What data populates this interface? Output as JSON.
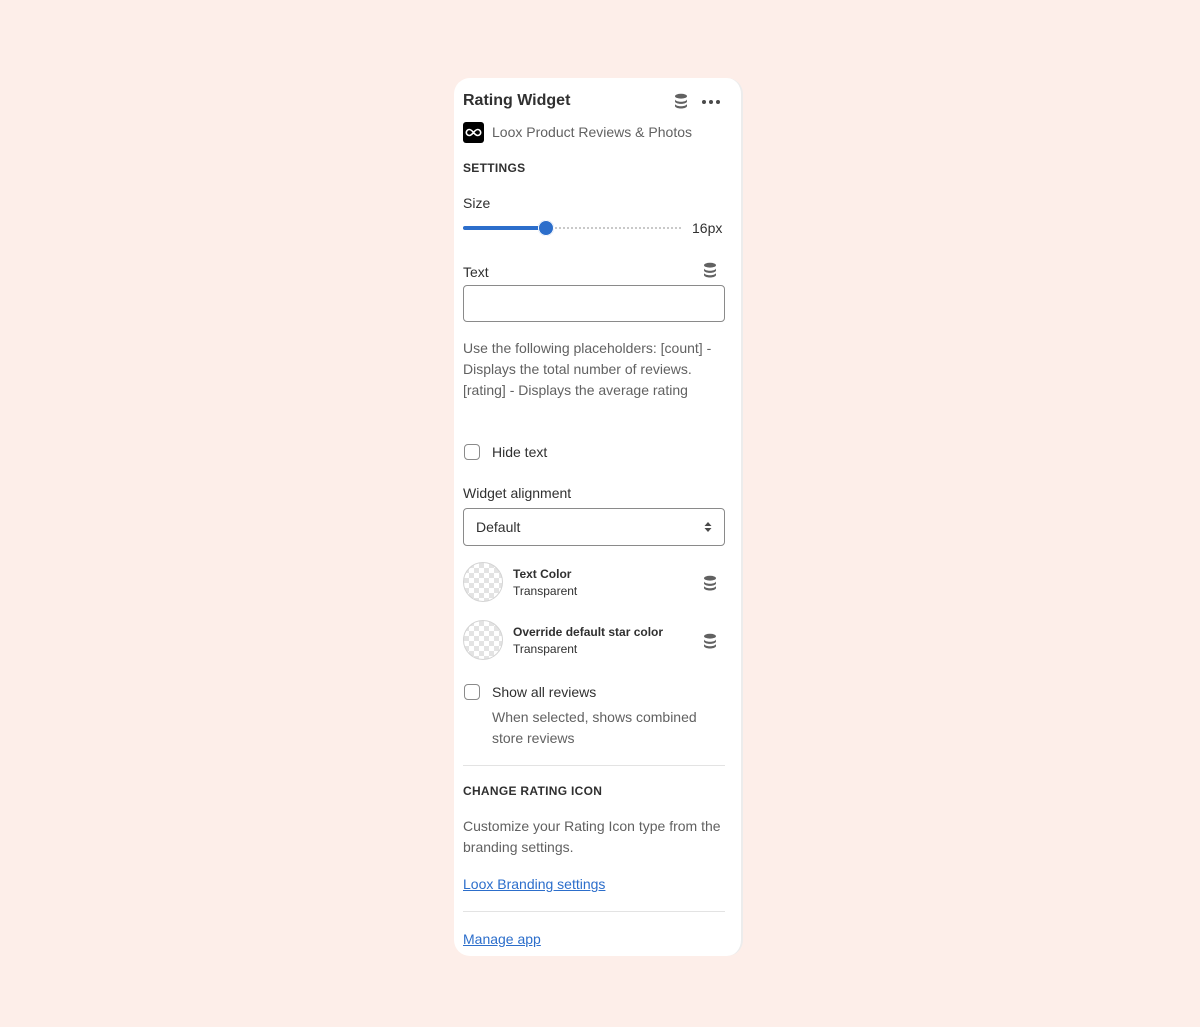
{
  "header": {
    "title": "Rating Widget",
    "icons": [
      "database-icon",
      "more-horizontal-icon"
    ]
  },
  "app": {
    "name": "Loox Product Reviews & Photos",
    "logo_icon": "infinity-icon"
  },
  "settings": {
    "section_title": "SETTINGS",
    "size": {
      "label": "Size",
      "value": 16,
      "min": 0,
      "max": 100,
      "value_label": "16px"
    },
    "text": {
      "label": "Text",
      "value": "",
      "placeholder": "",
      "help": "Use the following placeholders: [count] - Displays the total number of reviews. [rating] - Displays the average rating"
    },
    "hide_text": {
      "label": "Hide text",
      "checked": false
    },
    "widget_alignment": {
      "label": "Widget alignment",
      "selected": "Default"
    },
    "text_color": {
      "title": "Text Color",
      "value": "Transparent"
    },
    "star_color": {
      "title": "Override default star color",
      "value": "Transparent"
    },
    "show_all_reviews": {
      "label": "Show all reviews",
      "checked": false,
      "help": "When selected, shows combined store reviews"
    }
  },
  "rating_icon": {
    "section_title": "CHANGE RATING ICON",
    "help": "Customize your Rating Icon type from the branding settings.",
    "link": "Loox Branding settings"
  },
  "footer": {
    "manage_link": "Manage app"
  },
  "colors": {
    "background": "#fdeee9",
    "accent": "#2c6ecb",
    "panel": "#ffffff"
  }
}
